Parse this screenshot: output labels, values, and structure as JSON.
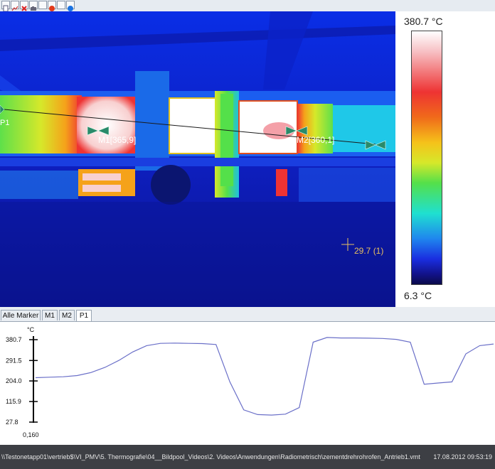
{
  "toolbar": {
    "icons": [
      "page-icon",
      "line-chart-icon",
      "delete-icon",
      "camera-icon",
      "checkbox-icon",
      "red-dot-icon",
      "checkbox-icon",
      "blue-dot-icon"
    ]
  },
  "thermal": {
    "marker1": "M1[365,9]",
    "marker2": "M2[360,1]",
    "profile_label": "P1",
    "cursor_readout": "29.7 (1)"
  },
  "scale": {
    "max_label": "380.7 °C",
    "min_label": "6.3 °C",
    "colors": [
      "#ffffff",
      "#ee3333",
      "#f5c21a",
      "#54e04a",
      "#1fe0d0",
      "#1a2ee0",
      "#0b0b4a"
    ]
  },
  "tabs": [
    {
      "label": "Alle Marker",
      "active": false
    },
    {
      "label": "M1",
      "active": false
    },
    {
      "label": "M2",
      "active": false
    },
    {
      "label": "P1",
      "active": true
    }
  ],
  "chart_data": {
    "type": "line",
    "title": "",
    "xlabel": "",
    "ylabel": "°C",
    "yticks": [
      "380.7",
      "291.5",
      "204.0",
      "115.9",
      "27.8"
    ],
    "x_start_label": "0,160",
    "ylim": [
      27.8,
      380.7
    ],
    "series": [
      {
        "values": [
          218,
          220,
          222,
          227,
          240,
          262,
          292,
          328,
          355,
          365,
          366,
          365,
          364,
          360,
          200,
          80,
          60,
          58,
          62,
          90,
          370,
          390,
          388,
          388,
          387,
          386,
          382,
          370,
          190,
          195,
          200,
          320,
          355,
          362
        ]
      }
    ]
  },
  "status": {
    "path": "\\\\Testonetapp01\\vertrieb$\\VI_PMV\\5. Thermografie\\04__Bildpool_Videos\\2. Videos\\Anwendungen\\Radiometrisch\\zementdrehrohrofen_Antrieb1.vmt",
    "timestamp": "17.08.2012  09:53:19"
  }
}
